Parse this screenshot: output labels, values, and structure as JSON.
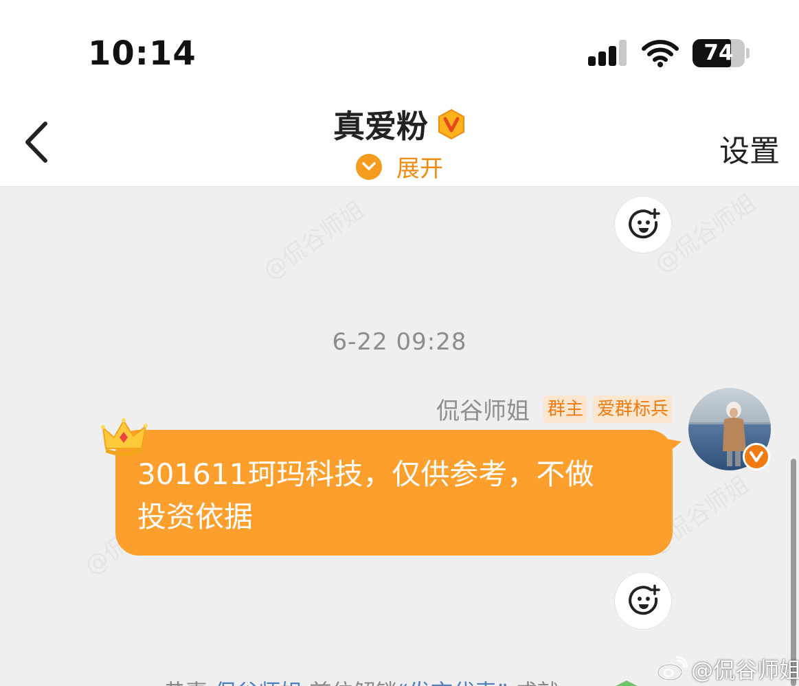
{
  "status_bar": {
    "time": "10:14",
    "battery": "74",
    "battery_level": 0.74,
    "signal_bars_active": 3,
    "icons": [
      "signal-icon",
      "wifi-icon",
      "battery-icon"
    ]
  },
  "nav": {
    "back_icon": "chevron-left-icon",
    "title": "真爱粉",
    "badge_icon": "vip-v-badge-icon",
    "expand_icon": "chevron-down-circle-icon",
    "expand_label": "展开",
    "settings_label": "设置"
  },
  "chat": {
    "watermark": "@侃谷师姐",
    "timestamp": "6-22 09:28",
    "message": {
      "sender": "侃谷师姐",
      "tags": [
        "群主",
        "爱群标兵"
      ],
      "crown_icon": "crown-icon",
      "avatar_badge_icon": "verified-v-icon",
      "text_line1": "301611珂玛科技，仅供参考，不做",
      "text_line2": "投资依据"
    },
    "reaction_icon": "add-emoji-reaction-icon",
    "system_notice": {
      "prefix": "恭喜",
      "user": "侃谷师姐",
      "middle": "首位解锁",
      "achievement": "“发言代表”",
      "suffix": "成就"
    },
    "corner_watermark": "@侃谷师姐"
  },
  "colors": {
    "bubble": "#fd9f2d",
    "accent": "#f08b10",
    "tag_bg": "#fbe6cf",
    "chat_bg": "#efefef",
    "link": "#4f7ec0"
  }
}
